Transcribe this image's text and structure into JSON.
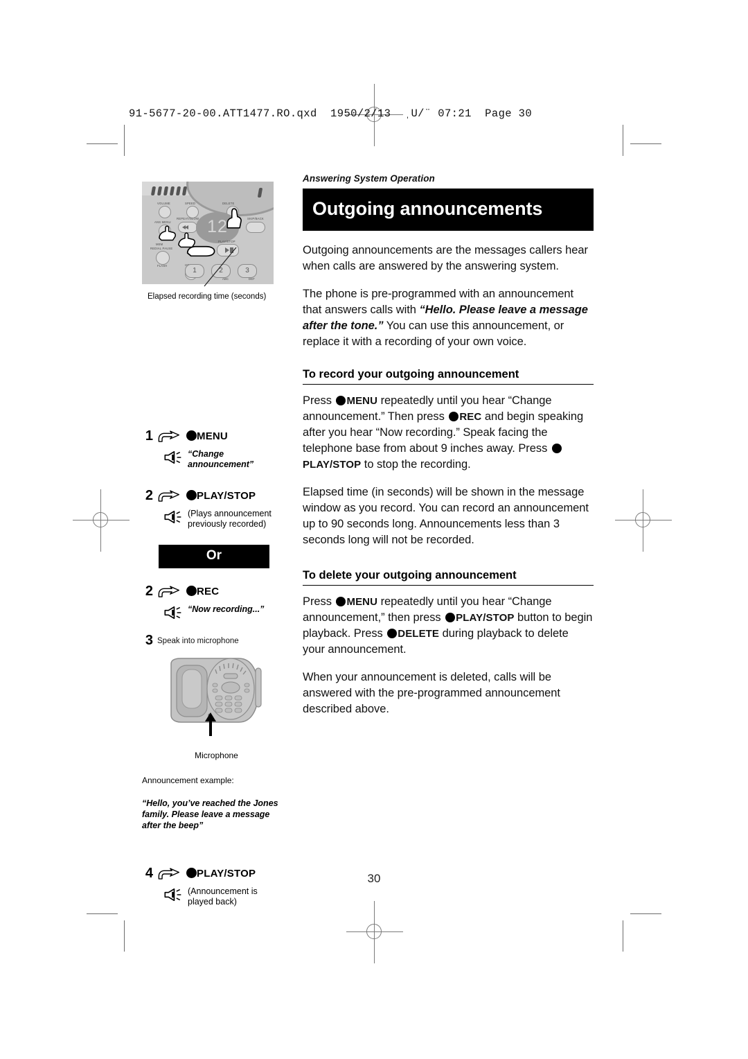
{
  "prepress": {
    "file_header": "91-5677-20-00.ATT1477.RO.qxd  1950/2/13  ˌU/¨ 07:21  Page 30"
  },
  "page": {
    "number": "30"
  },
  "right_column": {
    "kicker": "Answering System Operation",
    "title": "Outgoing announcements",
    "intro_paragraph": "Outgoing announcements are the messages callers hear when calls are answered by the answering system.",
    "preprogrammed": {
      "before": "The phone is pre-programmed with an announcement that answers calls with ",
      "quote": "“Hello. Please leave a message after the tone.”",
      "after": " You can use this announcement, or replace it with a recording of your own voice."
    },
    "record_section": {
      "heading": "To record your outgoing announcement",
      "p1_a": "Press ",
      "p1_btn1": "MENU",
      "p1_b": " repeatedly until you hear “Change announcement.” Then press ",
      "p1_btn2": "REC",
      "p1_c": " and begin speaking after you hear “Now recording.” Speak facing the telephone base from about 9 inches away. Press ",
      "p1_btn3": "PLAY/STOP",
      "p1_d": " to stop the recording.",
      "p2": "Elapsed time (in seconds) will be shown in the message window as you record. You can record an announcement up to 90 seconds long. Announcements less than 3 seconds long will not be recorded."
    },
    "delete_section": {
      "heading": "To delete your outgoing announcement",
      "p1_a": "Press ",
      "p1_btn1": "MENU",
      "p1_b": " repeatedly until you hear “Change announcement,” then press ",
      "p1_btn2": "PLAY/STOP",
      "p1_c": " button to begin playback. Press ",
      "p1_btn3": "DELETE",
      "p1_d": " during playback to delete your announcement.",
      "p2": "When your announcement is deleted, calls will be answered with the pre-programmed announcement described above."
    }
  },
  "left_column": {
    "base_figure": {
      "display_value": "12",
      "key_labels": {
        "volume": "VOLUME",
        "speed": "SPEED",
        "delete": "DELETE",
        "ans_menu": "ANS MENU",
        "repeat_slow": "REPEAT/SLOW",
        "skip_back": "SKIP/BACK",
        "play_stop": "PLAY/STOP",
        "mem": "MEM",
        "redial_pause": "REDIAL PAUSE",
        "flash": "FLASH",
        "hold": "HOLD"
      },
      "numeric_keys": [
        {
          "digit": "1",
          "letters": ""
        },
        {
          "digit": "2",
          "letters": "ABC"
        },
        {
          "digit": "3",
          "letters": "DEF"
        }
      ],
      "callout": "Elapsed recording time (seconds)"
    },
    "steps": [
      {
        "number": "1",
        "button": "MENU",
        "speech": "“Change announcement”",
        "speech_style": "italic"
      },
      {
        "number": "2",
        "button": "PLAY/STOP",
        "speech": "(Plays announcement previously recorded)",
        "speech_style": "plain"
      },
      {
        "number": "2",
        "button": "REC",
        "speech": "“Now recording...”",
        "speech_style": "italic"
      },
      {
        "number": "4",
        "button": "PLAY/STOP",
        "speech": "(Announcement is played back)",
        "speech_style": "plain"
      }
    ],
    "or_divider": "Or",
    "step3": {
      "number": "3",
      "text": "Speak into microphone"
    },
    "phone_figure": {
      "microphone_label": "Microphone"
    },
    "announcement_example": {
      "label": "Announcement example:",
      "text": "“Hello, you’ve reached the Jones family. Please leave a message after the beep”"
    }
  }
}
